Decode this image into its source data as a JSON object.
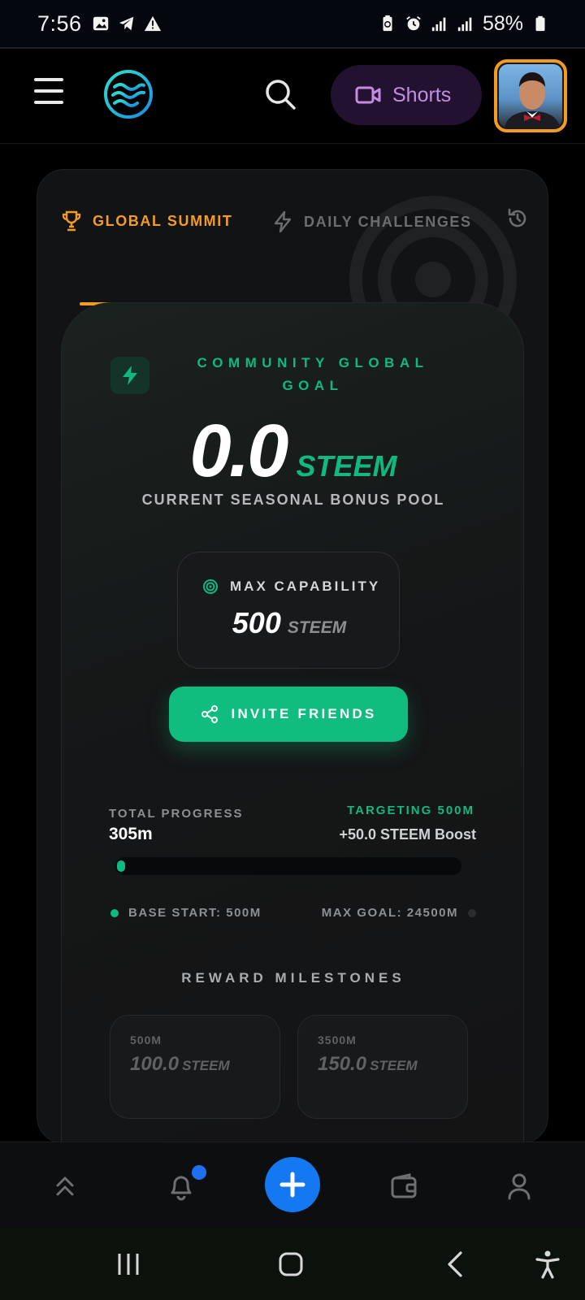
{
  "status_bar": {
    "time": "7:56",
    "battery": "58%",
    "icons": [
      "image-icon",
      "telegram-icon",
      "warning-icon",
      "battery-saver-icon",
      "alarm-icon",
      "signal-4g-icon",
      "signal-icon",
      "battery-icon"
    ]
  },
  "app_bar": {
    "menu_icon": "menu-icon",
    "logo_icon": "waves-logo-icon",
    "search_icon": "search-icon",
    "shorts_label": "Shorts",
    "shorts_icon": "video-camera-icon",
    "avatar_icon": "user-avatar"
  },
  "tabs": {
    "global": {
      "label": "GLOBAL SUMMIT",
      "icon": "trophy-icon",
      "active": true
    },
    "daily": {
      "label": "DAILY CHALLENGES",
      "icon": "bolt-icon",
      "active": false
    },
    "history_icon": "history-icon"
  },
  "goal": {
    "title": "COMMUNITY GLOBAL GOAL",
    "pool_value": "0.0",
    "pool_unit": "STEEM",
    "pool_caption": "CURRENT SEASONAL BONUS POOL",
    "capability_label": "MAX CAPABILITY",
    "capability_value": "500",
    "capability_unit": "STEEM",
    "invite_label": "INVITE FRIENDS"
  },
  "progress": {
    "label": "TOTAL PROGRESS",
    "value": "305m",
    "targeting": "TARGETING 500M",
    "boost": "+50.0 STEEM Boost",
    "fraction": 0.0,
    "base_start": "BASE START: 500M",
    "max_goal": "MAX GOAL: 24500M"
  },
  "milestones": {
    "title": "REWARD MILESTONES",
    "items": [
      {
        "threshold": "500M",
        "amount": "100.0",
        "unit": "STEEM"
      },
      {
        "threshold": "3500M",
        "amount": "150.0",
        "unit": "STEEM"
      }
    ]
  },
  "bottom_nav": {
    "items": [
      "chevrons-up-icon",
      "bell-icon",
      "plus-icon",
      "wallet-icon",
      "profile-icon"
    ],
    "notification_badge": true
  },
  "system_nav": {
    "items": [
      "recents-icon",
      "home-icon",
      "back-icon",
      "accessibility-icon"
    ]
  },
  "colors": {
    "accent_orange": "#f39c21",
    "accent_green": "#10b981",
    "fab_blue": "#1479f0",
    "shorts_purple": "#c58ce6"
  }
}
